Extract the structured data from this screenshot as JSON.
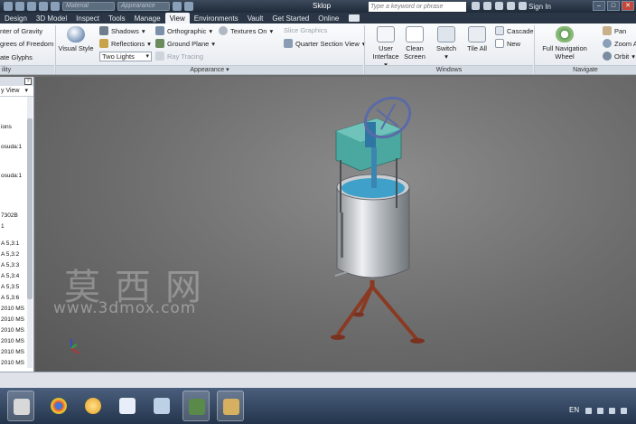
{
  "titlebar": {
    "material_placeholder": "Material",
    "appearance_placeholder": "Appearance",
    "document_title": "Sklop",
    "search_placeholder": "Type a keyword or phrase",
    "sign_in": "Sign In"
  },
  "tabs": [
    {
      "label": "Design"
    },
    {
      "label": "3D Model"
    },
    {
      "label": "Inspect"
    },
    {
      "label": "Tools"
    },
    {
      "label": "Manage"
    },
    {
      "label": "View"
    },
    {
      "label": "Environments"
    },
    {
      "label": "Vault"
    },
    {
      "label": "Get Started"
    },
    {
      "label": "Online"
    }
  ],
  "active_tab": "View",
  "ribbon": {
    "visibility": {
      "items": [
        "nter of Gravity",
        "grees of Freedom",
        "ate Glyphs"
      ],
      "label": "ility"
    },
    "appearance": {
      "visual_style": "Visual Style",
      "shadows": "Shadows",
      "reflections": "Reflections",
      "lighting": "Two Lights",
      "orthographic": "Orthographic",
      "ground_plane": "Ground Plane",
      "ray_tracing": "Ray Tracing",
      "textures_on": "Textures On",
      "slice_graphics": "Slice Graphics",
      "quarter_section_view": "Quarter Section View",
      "label": "Appearance"
    },
    "windows": {
      "user_interface": "User Interface",
      "clean_screen": "Clean Screen",
      "switch": "Switch",
      "tile_all": "Tile All",
      "cascade": "Cascade",
      "new": "New",
      "label": "Windows"
    },
    "navigate": {
      "full_navigation_wheel": "Full Navigation Wheel",
      "pan": "Pan",
      "zoom_all": "Zoom A",
      "orbit": "Orbit",
      "label": "Navigate"
    }
  },
  "browser": {
    "view_label": "y View",
    "items": [
      "ions",
      "osuda:1",
      "osuda:1",
      "7302B",
      "1",
      "A 5,3:1",
      "A 5,3:2",
      "A 5,3:3",
      "A 5,3:4",
      "A 5,3:5",
      "A 5,3:6",
      "2010 MS",
      "2010 MS",
      "2010 MS",
      "2010 MS",
      "2010 MS",
      "2010 MS"
    ]
  },
  "watermark": {
    "chinese": "莫西网",
    "url": "www.3dmox.com"
  },
  "taskbar": {
    "language": "EN"
  },
  "colors": {
    "titlebar": "#1f2a38",
    "ribbon": "#e4e8ee",
    "viewport": "#6c6c6c",
    "model_tank": "#c0c4c8",
    "model_top": "#4aa8a0",
    "model_stand": "#8a3a22",
    "model_wheel": "#5b6aa8"
  }
}
